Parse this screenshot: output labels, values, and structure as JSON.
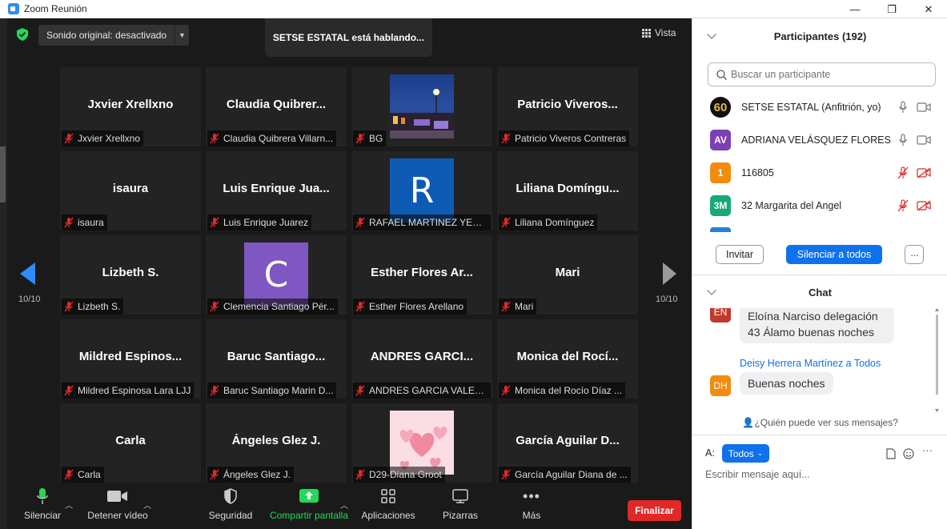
{
  "window": {
    "title": "Zoom Reunión"
  },
  "top": {
    "sound_button": "Sonido original: desactivado",
    "speaking_banner": "SETSE ESTATAL está hablando...",
    "view_button": "Vista"
  },
  "tiles": [
    {
      "big": "Jxvier Xrellxno",
      "label": "Jxvier Xrellxno",
      "kind": "name"
    },
    {
      "big": "Claudia  Quibrer...",
      "label": "Claudia Quibrera Villarn...",
      "kind": "name"
    },
    {
      "big": "",
      "label": "BG",
      "kind": "photo-night"
    },
    {
      "big": "Patricio  Viveros...",
      "label": "Patricio Viveros Contreras",
      "kind": "name"
    },
    {
      "big": "isaura",
      "label": "isaura",
      "kind": "name"
    },
    {
      "big": "Luis  Enrique  Jua...",
      "label": "Luis Enrique Juarez",
      "kind": "name"
    },
    {
      "big": "R",
      "label": "RAFAEL MARTINEZ YEDRA",
      "kind": "letter-blue"
    },
    {
      "big": "Liliana  Domíngu...",
      "label": "Liliana Domínguez",
      "kind": "name"
    },
    {
      "big": "Lizbeth S.",
      "label": "Lizbeth S.",
      "kind": "name"
    },
    {
      "big": "C",
      "label": "Clemencia  Santiago Pér...",
      "kind": "letter-purple"
    },
    {
      "big": "Esther Flores Ar...",
      "label": "Esther Flores Arellano",
      "kind": "name"
    },
    {
      "big": "Mari",
      "label": "Mari",
      "kind": "name"
    },
    {
      "big": "Mildred  Espinos...",
      "label": "Mildred Espinosa Lara LJJ",
      "kind": "name"
    },
    {
      "big": "Baruc  Santiago...",
      "label": "Baruc Santiago Marin D...",
      "kind": "name"
    },
    {
      "big": "ANDRES  GARCI...",
      "label": "ANDRES GARCIA VALENTI",
      "kind": "name"
    },
    {
      "big": "Monica  del  Rocí...",
      "label": "Monica del Rocío Díaz ...",
      "kind": "name"
    },
    {
      "big": "Carla",
      "label": "Carla",
      "kind": "name"
    },
    {
      "big": "Ángeles Glez J.",
      "label": "Ángeles Glez J.",
      "kind": "name"
    },
    {
      "big": "",
      "label": "D29-Diana Groot",
      "kind": "photo-hearts"
    },
    {
      "big": "García  Aguilar  D...",
      "label": "García Aguilar Diana de ...",
      "kind": "name"
    }
  ],
  "pagination": {
    "left": "10/10",
    "right": "10/10"
  },
  "toolbar": {
    "mute": "Silenciar",
    "video": "Detener vídeo",
    "security": "Seguridad",
    "share": "Compartir pantalla",
    "apps": "Aplicaciones",
    "whiteboards": "Pizarras",
    "more": "Más",
    "end": "Finalizar"
  },
  "participants": {
    "header": "Participantes (192)",
    "search_placeholder": "Buscar un participante",
    "items": [
      {
        "initials": "60",
        "name": "SETSE ESTATAL (Anfitrión, yo)",
        "color": "#1a1a1a",
        "muted": false
      },
      {
        "initials": "AV",
        "name": "ADRIANA VELÁSQUEZ FLORES",
        "color": "#7b3fb6",
        "muted": false
      },
      {
        "initials": "1",
        "name": "116805",
        "color": "#f28c0f",
        "muted": true
      },
      {
        "initials": "3M",
        "name": "32 Margarita del Angel",
        "color": "#19a974",
        "muted": true
      }
    ],
    "invite": "Invitar",
    "mute_all": "Silenciar a todos",
    "more": "···"
  },
  "chat": {
    "header": "Chat",
    "messages": [
      {
        "initials": "EN",
        "color": "#c0392b",
        "sender": "",
        "text": "Eloína Narciso delegación 43 Álamo buenas noches"
      },
      {
        "initials": "DH",
        "color": "#f28c0f",
        "sender": "Deisy Herrera Martínez a Todos",
        "text": "Buenas noches"
      }
    ],
    "msg1_line1": "Eloína Narciso delegación",
    "msg1_line2": "43 Álamo buenas noches",
    "who_can_see": "¿Quién puede ver sus mensajes?",
    "to_label": "A:",
    "to_value": "Todos",
    "input_placeholder": "Escribir mensaje aquí..."
  },
  "colors": {
    "accent": "#0e72ed",
    "end": "#e02828",
    "share": "#23d959"
  }
}
